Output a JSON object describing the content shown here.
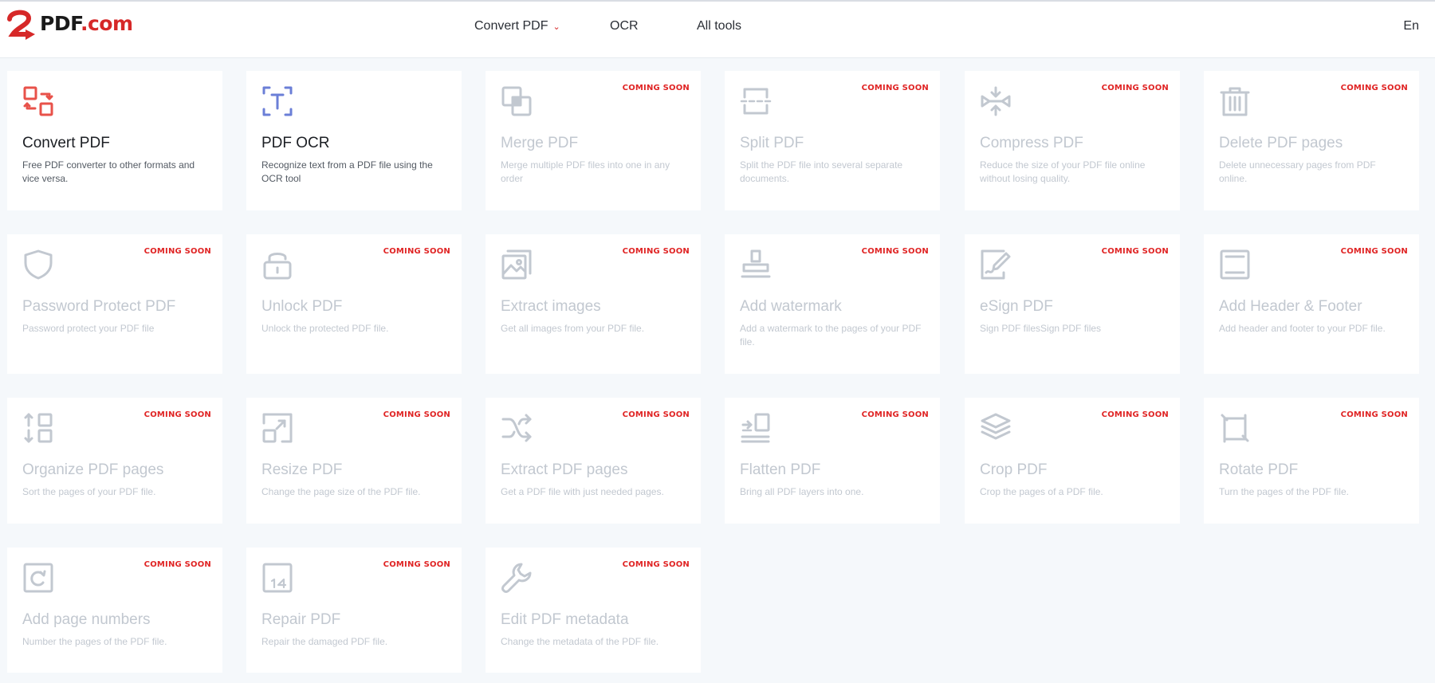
{
  "header": {
    "logo": {
      "mark": "2",
      "pdf": "PDF",
      "dotcom": ".com"
    },
    "nav": [
      {
        "label": "Convert PDF",
        "has_dropdown": true
      },
      {
        "label": "OCR"
      },
      {
        "label": "All tools"
      }
    ],
    "language": "En"
  },
  "badge_text": "COMING SOON",
  "colors": {
    "accent_red": "#e02424",
    "active_icon_red": "#e8524a",
    "active_icon_blue": "#6b7fd7",
    "disabled_gray": "#c2c8d0"
  },
  "tools": [
    {
      "id": "convert-pdf",
      "icon": "convert-icon",
      "title": "Convert PDF",
      "desc": "Free PDF converter to other formats and vice versa.",
      "coming_soon": false
    },
    {
      "id": "pdf-ocr",
      "icon": "ocr-icon",
      "title": "PDF OCR",
      "desc": "Recognize text from a PDF file using the OCR tool",
      "coming_soon": false
    },
    {
      "id": "merge-pdf",
      "icon": "merge-icon",
      "title": "Merge PDF",
      "desc": "Merge multiple PDF files into one in any order",
      "coming_soon": true
    },
    {
      "id": "split-pdf",
      "icon": "split-icon",
      "title": "Split PDF",
      "desc": "Split the PDF file into several separate documents.",
      "coming_soon": true
    },
    {
      "id": "compress-pdf",
      "icon": "compress-icon",
      "title": "Compress PDF",
      "desc": "Reduce the size of your PDF file online without losing quality.",
      "coming_soon": true
    },
    {
      "id": "delete-pdf-pages",
      "icon": "trash-icon",
      "title": "Delete PDF pages",
      "desc": "Delete unnecessary pages from PDF online.",
      "coming_soon": true
    },
    {
      "id": "password-protect-pdf",
      "icon": "shield-icon",
      "title": "Password Protect PDF",
      "desc": "Password protect your PDF file",
      "coming_soon": true
    },
    {
      "id": "unlock-pdf",
      "icon": "unlock-icon",
      "title": "Unlock PDF",
      "desc": "Unlock the protected PDF file.",
      "coming_soon": true
    },
    {
      "id": "extract-images",
      "icon": "images-icon",
      "title": "Extract images",
      "desc": "Get all images from your PDF file.",
      "coming_soon": true
    },
    {
      "id": "add-watermark",
      "icon": "stamp-icon",
      "title": "Add watermark",
      "desc": "Add a watermark to the pages of your PDF file.",
      "coming_soon": true
    },
    {
      "id": "esign-pdf",
      "icon": "sign-icon",
      "title": "eSign PDF",
      "desc": "Sign PDF filesSign PDF files",
      "coming_soon": true
    },
    {
      "id": "add-header-footer",
      "icon": "header-footer-icon",
      "title": "Add Header & Footer",
      "desc": "Add header and footer to your PDF file.",
      "coming_soon": true
    },
    {
      "id": "organize-pdf-pages",
      "icon": "organize-icon",
      "title": "Organize PDF pages",
      "desc": "Sort the pages of your PDF file.",
      "coming_soon": true
    },
    {
      "id": "resize-pdf",
      "icon": "resize-icon",
      "title": "Resize PDF",
      "desc": "Change the page size of the PDF file.",
      "coming_soon": true
    },
    {
      "id": "extract-pdf-pages",
      "icon": "shuffle-icon",
      "title": "Extract PDF pages",
      "desc": "Get a PDF file with just needed pages.",
      "coming_soon": true
    },
    {
      "id": "flatten-pdf",
      "icon": "flatten-icon",
      "title": "Flatten PDF",
      "desc": "Bring all PDF layers into one.",
      "coming_soon": true
    },
    {
      "id": "crop-pdf",
      "icon": "layers-icon",
      "title": "Crop PDF",
      "desc": "Crop the pages of a PDF file.",
      "coming_soon": true
    },
    {
      "id": "rotate-pdf",
      "icon": "rotate-icon",
      "title": "Rotate PDF",
      "desc": "Turn the pages of the PDF file.",
      "coming_soon": true
    },
    {
      "id": "add-page-numbers",
      "icon": "page-number-icon",
      "title": "Add page numbers",
      "desc": "Number the pages of the PDF file.",
      "coming_soon": true
    },
    {
      "id": "repair-pdf",
      "icon": "repair-icon",
      "title": "Repair PDF",
      "desc": "Repair the damaged PDF file.",
      "coming_soon": true
    },
    {
      "id": "edit-pdf-metadata",
      "icon": "wrench-icon",
      "title": "Edit PDF metadata",
      "desc": "Change the metadata of the PDF file.",
      "coming_soon": true
    }
  ]
}
